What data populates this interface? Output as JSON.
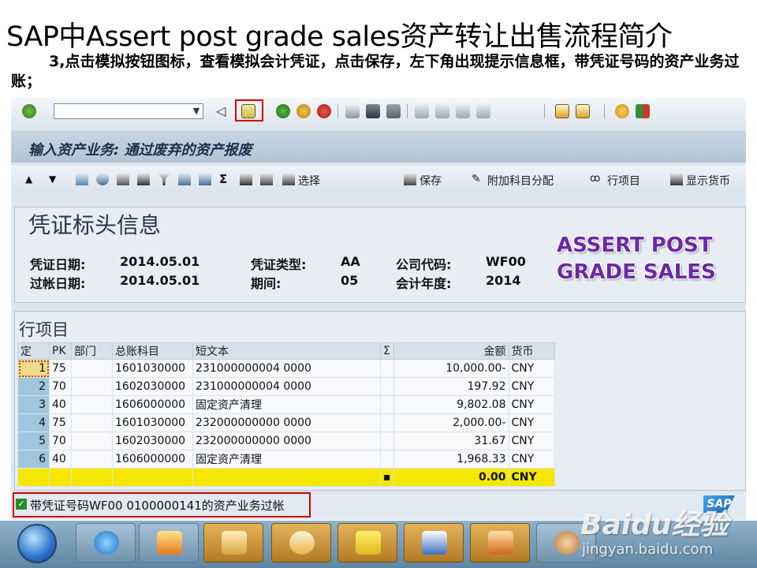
{
  "slide": {
    "title": "SAP中Assert post grade sales资产转让出售流程简介",
    "subtitle": "3,点击模拟按钮图标，查看模拟会计凭证，点击保存，左下角出现提示信息框，带凭证号码的资产业务过账；"
  },
  "screen": {
    "title": "输入资产业务: 通过废弃的资产报废"
  },
  "app_toolbar": {
    "select_label": "选择",
    "save_label": "保存",
    "assign_label": "附加科目分配",
    "line_items_label": "行项目",
    "show_currency_label": "显示货币"
  },
  "header": {
    "title": "凭证标头信息",
    "doc_date_label": "凭证日期:",
    "doc_date": "2014.05.01",
    "post_date_label": "过帐日期:",
    "post_date": "2014.05.01",
    "doc_type_label": "凭证类型:",
    "doc_type": "AA",
    "period_label": "期间:",
    "period": "05",
    "company_label": "公司代码:",
    "company": "WF00",
    "fiscal_year_label": "会计年度:",
    "fiscal_year": "2014"
  },
  "overlay": {
    "line1": "ASSERT POST",
    "line2": "GRADE SALES"
  },
  "items": {
    "title": "行项目",
    "columns": [
      "定",
      "PK",
      "部门",
      "总账科目",
      "短文本",
      "Σ",
      "金额",
      "货币"
    ],
    "rows": [
      {
        "no": "1",
        "pk": "75",
        "dept": "",
        "gl": "1601030000",
        "text": "231000000004 0000",
        "amount": "10,000.00-",
        "currency": "CNY"
      },
      {
        "no": "2",
        "pk": "70",
        "dept": "",
        "gl": "1602030000",
        "text": "231000000004 0000",
        "amount": "197.92",
        "currency": "CNY"
      },
      {
        "no": "3",
        "pk": "40",
        "dept": "",
        "gl": "1606000000",
        "text": "固定资产清理",
        "amount": "9,802.08",
        "currency": "CNY"
      },
      {
        "no": "4",
        "pk": "75",
        "dept": "",
        "gl": "1601030000",
        "text": "232000000000 0000",
        "amount": "2,000.00-",
        "currency": "CNY"
      },
      {
        "no": "5",
        "pk": "70",
        "dept": "",
        "gl": "1602030000",
        "text": "232000000000 0000",
        "amount": "31.67",
        "currency": "CNY"
      },
      {
        "no": "6",
        "pk": "40",
        "dept": "",
        "gl": "1606000000",
        "text": "固定资产清理",
        "amount": "1,968.33",
        "currency": "CNY"
      }
    ],
    "total_marker": "▪",
    "total_amount": "0.00",
    "total_currency": "CNY"
  },
  "status": {
    "check": "✓",
    "message": "带凭证号码WF00 0100000141的资产业务过帐"
  },
  "logo": {
    "text": "SAP"
  },
  "watermark": {
    "brand": "Baidu经验",
    "url": "jingyan.baidu.com"
  },
  "colors": {
    "highlight": "#d40000",
    "total_row": "#f5e700",
    "overlay_text": "#6a2aa4"
  },
  "icons": {
    "std_toolbar": [
      "enter-icon",
      "back-icon",
      "save-icon",
      "back-nav-icon",
      "exit-icon",
      "cancel-icon",
      "print-icon",
      "find-icon",
      "find-next-icon",
      "first-page-icon",
      "prev-page-icon",
      "next-page-icon",
      "last-page-icon",
      "new-session-icon",
      "shortcut-icon",
      "help-icon",
      "layout-icon"
    ],
    "taskbar": [
      "start-orb-icon",
      "ie-icon",
      "media-player-icon",
      "explorer-icon",
      "outlook-icon",
      "network-icon",
      "word-icon",
      "powerpoint-icon",
      "paint-icon"
    ]
  }
}
